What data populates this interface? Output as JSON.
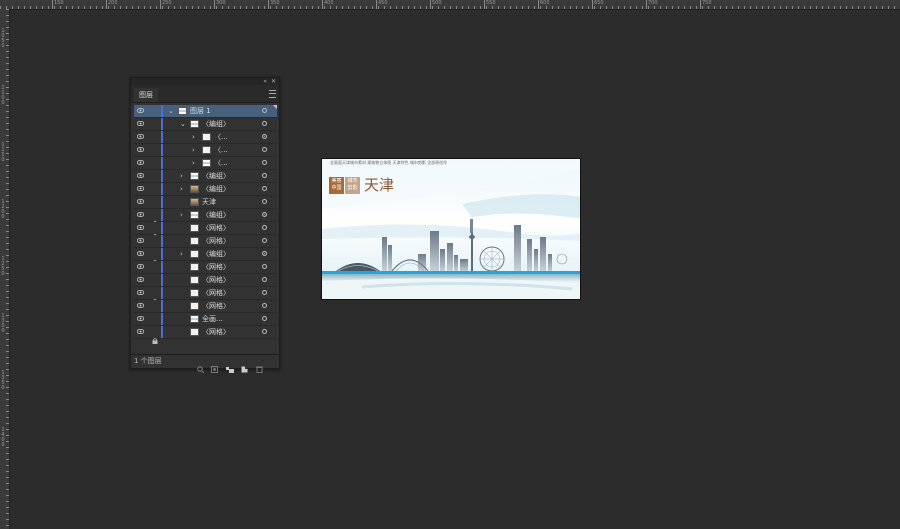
{
  "rulers": {
    "top": [
      "150",
      "200",
      "250",
      "300",
      "350",
      "400",
      "450",
      "500",
      "550",
      "600",
      "650",
      "700",
      "750"
    ],
    "left": [
      "1050",
      "1100",
      "1150",
      "1200",
      "1250",
      "1300",
      "1350",
      "1400"
    ]
  },
  "panel": {
    "tab_label": "图层",
    "collapse_glyph": "«",
    "close_glyph": "✕",
    "footer_count": "1 个图层",
    "colors": {
      "selection": "#46607e",
      "layer_color": "#4a6fd1"
    }
  },
  "layers": [
    {
      "name": "图层 1",
      "eye": true,
      "lock": false,
      "expand": "open",
      "indent": 0,
      "thumb": "sky",
      "target": "open",
      "selected": true
    },
    {
      "name": "〈编组〉",
      "eye": true,
      "lock": false,
      "expand": "open",
      "indent": 1,
      "thumb": "sky",
      "target": "open"
    },
    {
      "name": "〈...",
      "eye": true,
      "lock": false,
      "expand": "closed",
      "indent": 2,
      "thumb": "blank",
      "target": "filled"
    },
    {
      "name": "〈...",
      "eye": true,
      "lock": false,
      "expand": "closed",
      "indent": 2,
      "thumb": "blank",
      "target": "open"
    },
    {
      "name": "〈...",
      "eye": true,
      "lock": false,
      "expand": "closed",
      "indent": 2,
      "thumb": "sky",
      "target": "open"
    },
    {
      "name": "〈编组〉",
      "eye": true,
      "lock": false,
      "expand": "closed",
      "indent": 1,
      "thumb": "sky",
      "target": "open"
    },
    {
      "name": "〈编组〉",
      "eye": true,
      "lock": false,
      "expand": "closed",
      "indent": 1,
      "thumb": "pic",
      "target": "open"
    },
    {
      "name": "天津",
      "eye": true,
      "lock": false,
      "expand": "none",
      "indent": 1,
      "thumb": "pic",
      "target": "open"
    },
    {
      "name": "〈编组〉",
      "eye": true,
      "lock": true,
      "expand": "closed",
      "indent": 1,
      "thumb": "sky",
      "target": "filled"
    },
    {
      "name": "〈网格〉",
      "eye": true,
      "lock": true,
      "expand": "none",
      "indent": 1,
      "thumb": "blank",
      "target": "open"
    },
    {
      "name": "〈网格〉",
      "eye": true,
      "lock": false,
      "expand": "none",
      "indent": 1,
      "thumb": "blank",
      "target": "open"
    },
    {
      "name": "〈编组〉",
      "eye": true,
      "lock": true,
      "expand": "closed",
      "indent": 1,
      "thumb": "blank",
      "target": "filled"
    },
    {
      "name": "〈网格〉",
      "eye": true,
      "lock": false,
      "expand": "none",
      "indent": 1,
      "thumb": "blank",
      "target": "open"
    },
    {
      "name": "〈网格〉",
      "eye": true,
      "lock": false,
      "expand": "none",
      "indent": 1,
      "thumb": "blank",
      "target": "open"
    },
    {
      "name": "〈网格〉",
      "eye": true,
      "lock": true,
      "expand": "none",
      "indent": 1,
      "thumb": "blank",
      "target": "open"
    },
    {
      "name": "〈网格〉",
      "eye": true,
      "lock": false,
      "expand": "none",
      "indent": 1,
      "thumb": "blank",
      "target": "open"
    },
    {
      "name": "全画...",
      "eye": true,
      "lock": false,
      "expand": "none",
      "indent": 1,
      "thumb": "sky",
      "target": "open"
    },
    {
      "name": "〈网格〉",
      "eye": true,
      "lock": true,
      "expand": "none",
      "indent": 1,
      "thumb": "blank",
      "target": "open"
    }
  ],
  "artboard": {
    "top_text": "全画面天津城市素材  建筑物立体图  天津特色  城市剪影  全部原创作",
    "badge_left": [
      "美丽",
      "中国"
    ],
    "badge_right": [
      "城市",
      "剪影"
    ],
    "city_name": "天津",
    "colors": {
      "title": "#8a5a36",
      "sky": "#dbeef4",
      "accent": "#2fb8e6"
    }
  }
}
